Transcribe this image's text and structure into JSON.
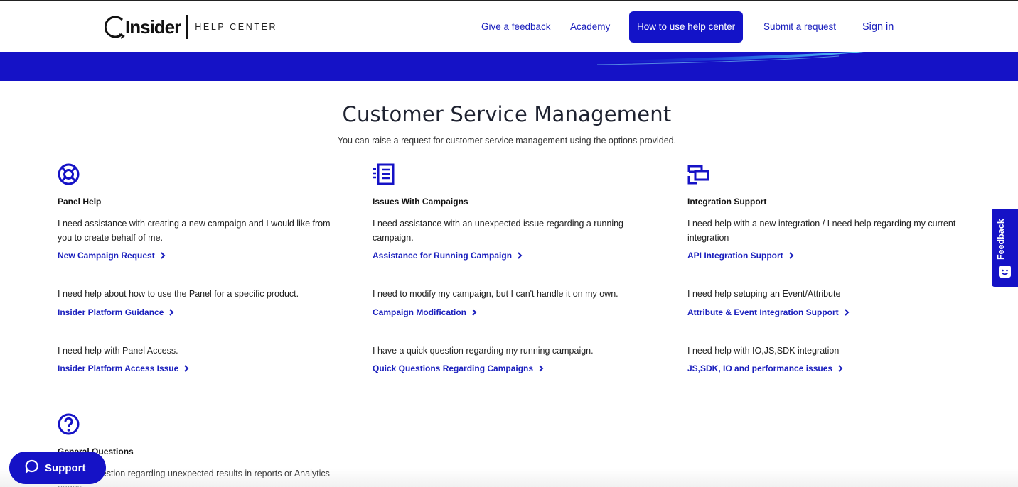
{
  "brand": {
    "name": "Insider",
    "section": "HELP CENTER",
    "accent": "#1512c6",
    "link_color": "#1a1fbd"
  },
  "nav": {
    "feedback": "Give a feedback",
    "academy": "Academy",
    "how_to": "How to use help center",
    "submit": "Submit a request",
    "signin": "Sign in"
  },
  "page": {
    "title": "Customer Service Management",
    "subtitle": "You can raise a request for customer service management using the options provided."
  },
  "categories": [
    {
      "icon": "lifebuoy-icon",
      "title": "Panel Help",
      "items": [
        {
          "desc": "I need assistance with creating a new campaign and I would like from you to create behalf of me.",
          "link": "New Campaign Request"
        },
        {
          "desc": "I need help about how to use the Panel for a specific product.",
          "link": "Insider Platform Guidance"
        },
        {
          "desc": "I need help with Panel Access.",
          "link": "Insider Platform Access Issue"
        }
      ]
    },
    {
      "icon": "list-document-icon",
      "title": "Issues With Campaigns",
      "items": [
        {
          "desc": "I need assistance with an unexpected issue regarding a running campaign.",
          "link": "Assistance for Running Campaign"
        },
        {
          "desc": "I need to modify my campaign, but I can't handle it on my own.",
          "link": "Campaign Modification"
        },
        {
          "desc": "I have a quick question regarding my running campaign.",
          "link": "Quick Questions Regarding Campaigns"
        }
      ]
    },
    {
      "icon": "integration-icon",
      "title": "Integration Support",
      "items": [
        {
          "desc": "I need help with a new integration / I need help regarding my current integration",
          "link": "API Integration Support"
        },
        {
          "desc": "I need help setuping an Event/Attribute",
          "link": "Attribute & Event Integration Support"
        },
        {
          "desc": "I need help with IO,JS,SDK integration",
          "link": "JS,SDK, IO and performance issues"
        }
      ]
    },
    {
      "icon": "question-circle-icon",
      "title": "General Questions",
      "items": [
        {
          "desc": "I have a question regarding unexpected results in reports or Analytics pages",
          "link": ""
        }
      ]
    }
  ],
  "widgets": {
    "feedback_tab": "Feedback",
    "support_button": "Support"
  }
}
